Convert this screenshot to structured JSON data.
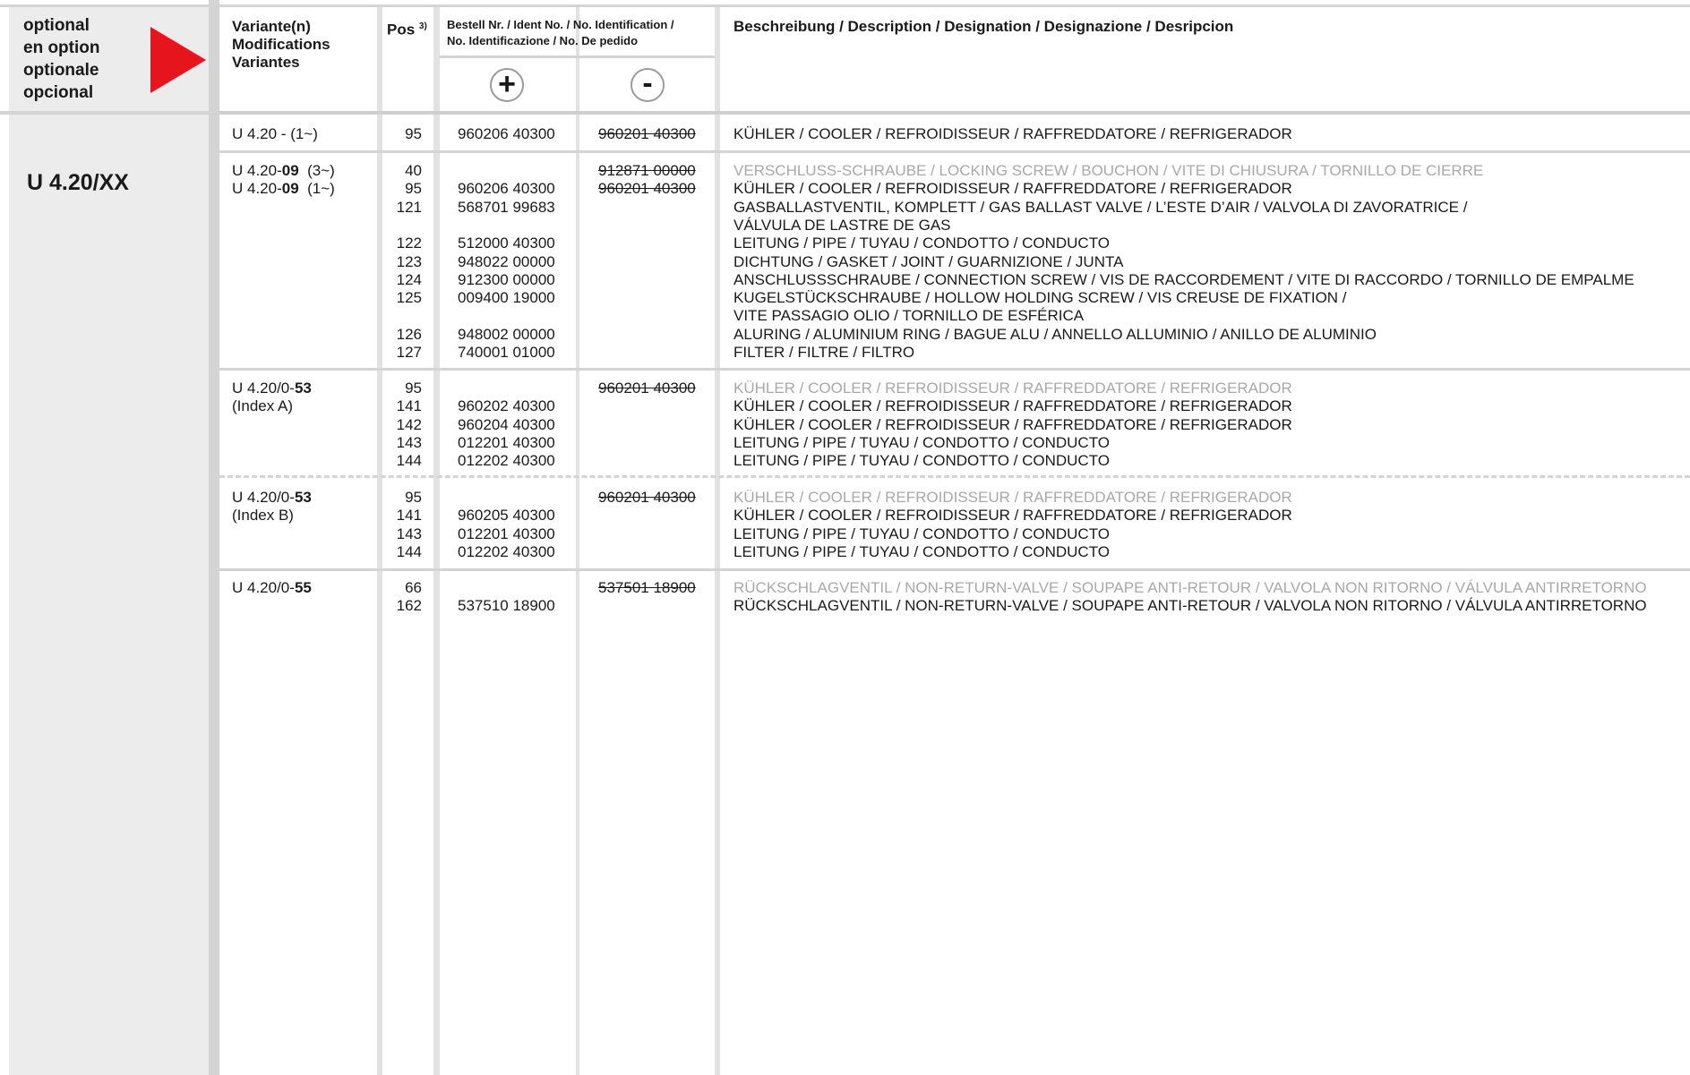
{
  "side": {
    "optional_labels": [
      "optional",
      "en option",
      "optionale",
      "opcional"
    ],
    "type_title": "U 4.20/XX",
    "arrow_color": "#e5141d"
  },
  "header": {
    "variant": [
      "Variante(n)",
      "Modifications",
      "Variantes"
    ],
    "pos": "Pos",
    "pos_note": "3)",
    "order": [
      "Bestell Nr. / Ident No. / No. Identification /",
      "No. Identificazione / No. De pedido"
    ],
    "add_symbol": "+",
    "remove_symbol": "-",
    "description": "Beschreibung / Description / Designation / Designazione / Desripcion"
  },
  "groups": [
    {
      "variant_lines": [
        [
          "U 4.20 - (1~)",
          "",
          ""
        ]
      ],
      "rows": [
        {
          "pos": "95",
          "add": "960206 40300",
          "remove": "960201 40300",
          "desc": "KÜHLER / COOLER / REFROIDISSEUR / RAFFREDDATORE / REFRIGERADOR",
          "muted": false
        }
      ]
    },
    {
      "variant_lines": [
        [
          "U 4.20-",
          "09",
          "  (3~)"
        ],
        [
          "U 4.20-",
          "09",
          "  (1~)"
        ]
      ],
      "rows": [
        {
          "pos": "40",
          "add": "",
          "remove": "912871 00000",
          "desc": "VERSCHLUSS-SCHRAUBE / LOCKING SCREW / BOUCHON / VITE DI CHIUSURA / TORNILLO DE CIERRE",
          "muted": true
        },
        {
          "pos": "95",
          "add": "960206 40300",
          "remove": "960201 40300",
          "desc": "KÜHLER / COOLER / REFROIDISSEUR / RAFFREDDATORE / REFRIGERADOR",
          "muted": false
        },
        {
          "pos": "121",
          "add": "568701 99683",
          "remove": "",
          "desc": "GASBALLASTVENTIL, KOMPLETT / GAS BALLAST VALVE / L’ESTE D’AIR / VALVOLA DI ZAVORATRICE /",
          "muted": false
        },
        {
          "pos": "",
          "add": "",
          "remove": "",
          "desc": "VÁLVULA DE LASTRE DE GAS",
          "muted": false
        },
        {
          "pos": "122",
          "add": "512000 40300",
          "remove": "",
          "desc": "LEITUNG / PIPE / TUYAU / CONDOTTO / CONDUCTO",
          "muted": false
        },
        {
          "pos": "123",
          "add": "948022 00000",
          "remove": "",
          "desc": "DICHTUNG / GASKET / JOINT / GUARNIZIONE / JUNTA",
          "muted": false
        },
        {
          "pos": "124",
          "add": "912300 00000",
          "remove": "",
          "desc": "ANSCHLUSSSCHRAUBE / CONNECTION SCREW / VIS DE RACCORDEMENT / VITE DI RACCORDO / TORNILLO DE EMPALME",
          "muted": false
        },
        {
          "pos": "125",
          "add": "009400 19000",
          "remove": "",
          "desc": "KUGELSTÜCKSCHRAUBE / HOLLOW HOLDING SCREW / VIS CREUSE DE FIXATION /",
          "muted": false
        },
        {
          "pos": "",
          "add": "",
          "remove": "",
          "desc": "VITE PASSAGIO OLIO / TORNILLO DE ESFÉRICA",
          "muted": false
        },
        {
          "pos": "126",
          "add": "948002 00000",
          "remove": "",
          "desc": "ALURING / ALUMINIUM RING / BAGUE ALU / ANNELLO ALLUMINIO / ANILLO DE ALUMINIO",
          "muted": false
        },
        {
          "pos": "127",
          "add": "740001 01000",
          "remove": "",
          "desc": "FILTER / FILTRE / FILTRO",
          "muted": false
        }
      ]
    },
    {
      "variant_lines": [
        [
          "U 4.20/0-",
          "53",
          ""
        ],
        [
          "(Index A)",
          "",
          ""
        ]
      ],
      "rows": [
        {
          "pos": "95",
          "add": "",
          "remove": "960201 40300",
          "desc": "KÜHLER / COOLER / REFROIDISSEUR / RAFFREDDATORE / REFRIGERADOR",
          "muted": true
        },
        {
          "pos": "141",
          "add": "960202 40300",
          "remove": "",
          "desc": "KÜHLER / COOLER / REFROIDISSEUR / RAFFREDDATORE / REFRIGERADOR",
          "muted": false
        },
        {
          "pos": "142",
          "add": "960204 40300",
          "remove": "",
          "desc": "KÜHLER / COOLER / REFROIDISSEUR / RAFFREDDATORE / REFRIGERADOR",
          "muted": false
        },
        {
          "pos": "143",
          "add": "012201 40300",
          "remove": "",
          "desc": "LEITUNG / PIPE / TUYAU / CONDOTTO / CONDUCTO",
          "muted": false
        },
        {
          "pos": "144",
          "add": "012202 40300",
          "remove": "",
          "desc": "LEITUNG / PIPE / TUYAU / CONDOTTO / CONDUCTO",
          "muted": false
        }
      ]
    },
    {
      "variant_lines": [
        [
          "U 4.20/0-",
          "53",
          ""
        ],
        [
          "(Index B)",
          "",
          ""
        ]
      ],
      "rows": [
        {
          "pos": "95",
          "add": "",
          "remove": "960201 40300",
          "desc": "KÜHLER / COOLER / REFROIDISSEUR / RAFFREDDATORE / REFRIGERADOR",
          "muted": true
        },
        {
          "pos": "141",
          "add": "960205 40300",
          "remove": "",
          "desc": "KÜHLER / COOLER / REFROIDISSEUR / RAFFREDDATORE / REFRIGERADOR",
          "muted": false
        },
        {
          "pos": "143",
          "add": "012201 40300",
          "remove": "",
          "desc": "LEITUNG / PIPE / TUYAU / CONDOTTO / CONDUCTO",
          "muted": false
        },
        {
          "pos": "144",
          "add": "012202 40300",
          "remove": "",
          "desc": "LEITUNG / PIPE / TUYAU / CONDOTTO / CONDUCTO",
          "muted": false
        }
      ]
    },
    {
      "variant_lines": [
        [
          "U 4.20/0-",
          "55",
          ""
        ]
      ],
      "rows": [
        {
          "pos": "66",
          "add": "",
          "remove": "537501 18900",
          "desc": "RÜCKSCHLAGVENTIL / NON-RETURN-VALVE / SOUPAPE ANTI-RETOUR / VALVOLA NON RITORNO / VÁLVULA ANTIRRETORNO",
          "muted": true
        },
        {
          "pos": "162",
          "add": "537510 18900",
          "remove": "",
          "desc": "RÜCKSCHLAGVENTIL / NON-RETURN-VALVE / SOUPAPE ANTI-RETOUR / VALVOLA NON RITORNO / VÁLVULA ANTIRRETORNO",
          "muted": false
        }
      ]
    }
  ]
}
